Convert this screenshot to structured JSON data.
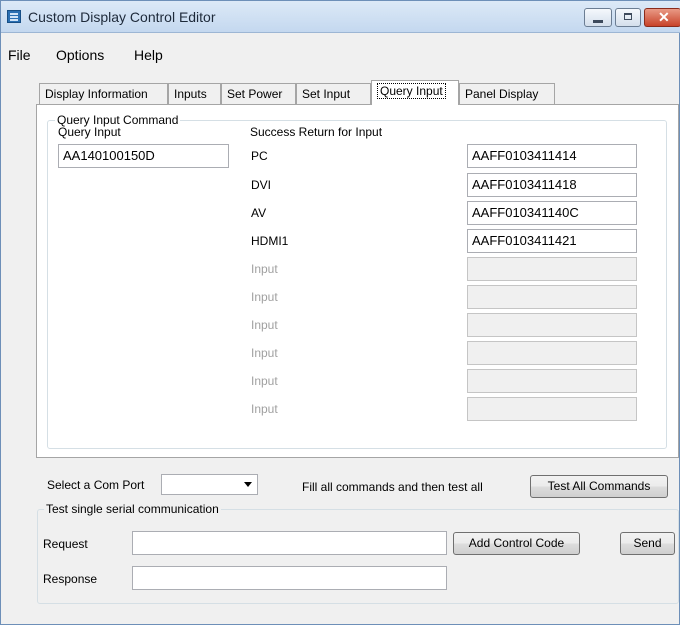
{
  "window": {
    "title": "Custom Display Control Editor"
  },
  "menu": [
    "File",
    "Options",
    "Help"
  ],
  "tabs": [
    "Display Information",
    "Inputs",
    "Set Power",
    "Set Input",
    "Query Input",
    "Panel Display"
  ],
  "active_tab": "Query Input",
  "query_group": {
    "caption": "Query Input Command",
    "query_label": "Query Input",
    "query_value": "AA140100150D",
    "success_label": "Success Return for Input",
    "rows": [
      {
        "label": "PC",
        "value": "AAFF0103411414"
      },
      {
        "label": "DVI",
        "value": "AAFF0103411418"
      },
      {
        "label": "AV",
        "value": "AAFF010341140C"
      },
      {
        "label": "HDMI1",
        "value": "AAFF0103411421"
      },
      {
        "label": "Input",
        "value": ""
      },
      {
        "label": "Input",
        "value": ""
      },
      {
        "label": "Input",
        "value": ""
      },
      {
        "label": "Input",
        "value": ""
      },
      {
        "label": "Input",
        "value": ""
      },
      {
        "label": "Input",
        "value": ""
      }
    ]
  },
  "com_port": {
    "label": "Select a Com Port",
    "value": ""
  },
  "fill_text": "Fill all commands and then test all",
  "test_all_button": "Test All Commands",
  "serial_group": {
    "caption": "Test single serial communication",
    "request_label": "Request",
    "request_value": "",
    "response_label": "Response",
    "response_value": "",
    "add_control_code_button": "Add Control Code",
    "send_button": "Send"
  },
  "colors": {
    "title_bar": "#c4d8ef",
    "close_button": "#c8432a",
    "window_bg": "#f0f0f0"
  }
}
